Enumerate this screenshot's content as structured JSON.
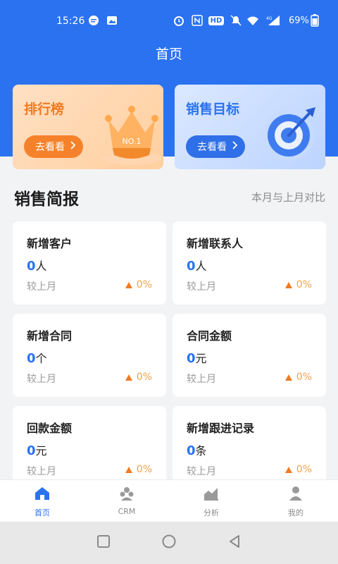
{
  "status_bar": {
    "time": "15:26",
    "battery": "69%",
    "network": "4G",
    "hd_badge": "HD",
    "icons": [
      "message-icon",
      "image-icon",
      "alarm-icon",
      "nfc-icon",
      "hd-icon",
      "mute-icon",
      "wifi-icon",
      "signal-icon",
      "battery-icon"
    ]
  },
  "header": {
    "title": "首页",
    "color": "#2b72f0"
  },
  "feature_cards": [
    {
      "title": "排行榜",
      "button": "去看看",
      "badge_text": "NO.1",
      "icon": "crown-icon",
      "accent": "#f5822a"
    },
    {
      "title": "销售目标",
      "button": "去看看",
      "icon": "target-icon",
      "accent": "#2f6fe8"
    }
  ],
  "section": {
    "title": "销售简报",
    "subtitle": "本月与上月对比"
  },
  "stats": [
    {
      "label": "新增客户",
      "value": "0",
      "unit": "人",
      "compare": "较上月",
      "trend": "0%"
    },
    {
      "label": "新增联系人",
      "value": "0",
      "unit": "人",
      "compare": "较上月",
      "trend": "0%"
    },
    {
      "label": "新增合同",
      "value": "0",
      "unit": "个",
      "compare": "较上月",
      "trend": "0%"
    },
    {
      "label": "合同金额",
      "value": "0",
      "unit": "元",
      "compare": "较上月",
      "trend": "0%"
    },
    {
      "label": "回款金额",
      "value": "0",
      "unit": "元",
      "compare": "较上月",
      "trend": "0%"
    },
    {
      "label": "新增跟进记录",
      "value": "0",
      "unit": "条",
      "compare": "较上月",
      "trend": "0%"
    }
  ],
  "bottom_nav": [
    {
      "label": "首页",
      "icon": "home-icon",
      "active": true
    },
    {
      "label": "CRM",
      "icon": "crm-icon",
      "active": false
    },
    {
      "label": "分析",
      "icon": "analysis-icon",
      "active": false
    },
    {
      "label": "我的",
      "icon": "profile-icon",
      "active": false
    }
  ],
  "system_nav": [
    "recents-icon",
    "home-circle-icon",
    "back-icon"
  ]
}
